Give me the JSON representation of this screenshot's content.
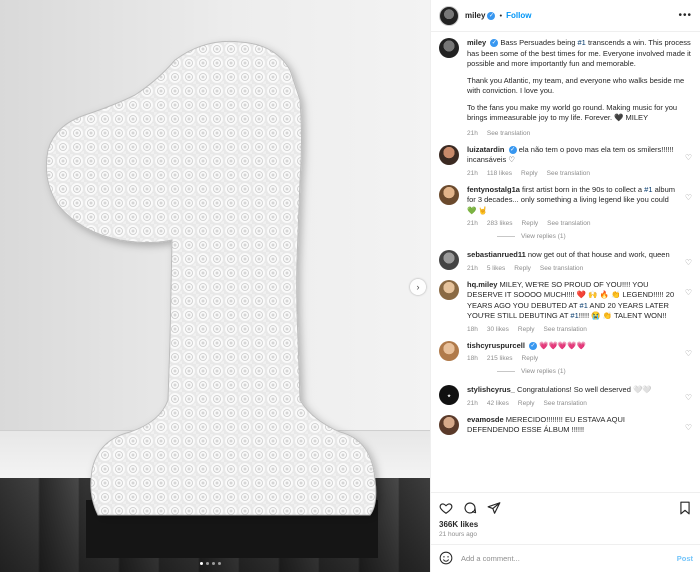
{
  "header": {
    "username": "miley",
    "separator": "•",
    "follow_label": "Follow",
    "more_label": "•••"
  },
  "caption": {
    "username": "miley",
    "paragraphs": [
      [
        "Bass Persuades being ",
        "#1",
        " transcends a win. This process has been some of the best times for me. Everyone involved made it possible and more importantly fun and memorable."
      ],
      [
        "Thank you Atlantic, my team, and everyone who walks beside me with conviction. I love you."
      ],
      [
        "To the fans you make my world go round. Making music for you brings immeasurable joy to my life. Forever. 🖤 MILEY"
      ]
    ],
    "time": "21h",
    "see_translation": "See translation"
  },
  "comments": [
    {
      "user": "luizatardin",
      "verified": true,
      "text": "ela não tem o povo mas ela tem os smilers!!!!!! incansáveis ♡",
      "time": "21h",
      "likes": "118 likes",
      "reply": "Reply",
      "translate": "See translation",
      "replies": ""
    },
    {
      "user": "fentynostalg1a",
      "verified": false,
      "text_parts": [
        "first artist born in the 90s to collect a ",
        "#1",
        " album for 3 decades... only something a living legend like you could 💚 🤘"
      ],
      "time": "21h",
      "likes": "283 likes",
      "reply": "Reply",
      "translate": "See translation",
      "replies": "View replies (1)"
    },
    {
      "user": "sebastianrued11",
      "verified": false,
      "text": "now get out of that house and work, queen",
      "time": "21h",
      "likes": "5 likes",
      "reply": "Reply",
      "translate": "See translation",
      "replies": ""
    },
    {
      "user": "hq.miley",
      "verified": false,
      "text_parts": [
        "MILEY, WE'RE SO PROUD OF YOU!!!! YOU DESERVE IT SOOOO MUCH!!!! ❤️ 🙌 🔥 👏 LEGEND!!!!! 20 YEARS AGO YOU DEBUTED AT ",
        "#1",
        " AND 20 YEARS LATER YOU'RE STILL DEBUTING AT ",
        "#1",
        "!!!!! 😭 👏 TALENT WON!!"
      ],
      "time": "18h",
      "likes": "30 likes",
      "reply": "Reply",
      "translate": "See translation",
      "replies": ""
    },
    {
      "user": "tishcyruspurcell",
      "verified": true,
      "text": "💗💗💗💗💗",
      "time": "18h",
      "likes": "215 likes",
      "reply": "Reply",
      "translate": "",
      "replies": "View replies (1)"
    },
    {
      "user": "stylishcyrus_",
      "verified": false,
      "text": "Congratulations! So well deserved 🤍🤍",
      "time": "21h",
      "likes": "42 likes",
      "reply": "Reply",
      "translate": "See translation",
      "replies": ""
    },
    {
      "user": "evamosde",
      "verified": false,
      "text": "MERECIDO!!!!!!!! EU ESTAVA AQUI DEFENDENDO ESSE ÁLBUM !!!!!!",
      "time": "",
      "likes": "",
      "reply": "",
      "translate": "",
      "replies": ""
    }
  ],
  "actions": {
    "likes": "366K likes",
    "ago": "21 hours ago"
  },
  "add_comment": {
    "placeholder": "Add a comment...",
    "post_label": "Post"
  },
  "colors": {
    "link": "#0095f6",
    "hashtag": "#00376b",
    "muted": "#8e8e8e",
    "text": "#262626"
  },
  "icons": [
    "heart-icon",
    "comment-icon",
    "share-icon",
    "bookmark-icon",
    "emoji-icon",
    "chevron-right-icon",
    "more-icon",
    "verified-icon"
  ]
}
